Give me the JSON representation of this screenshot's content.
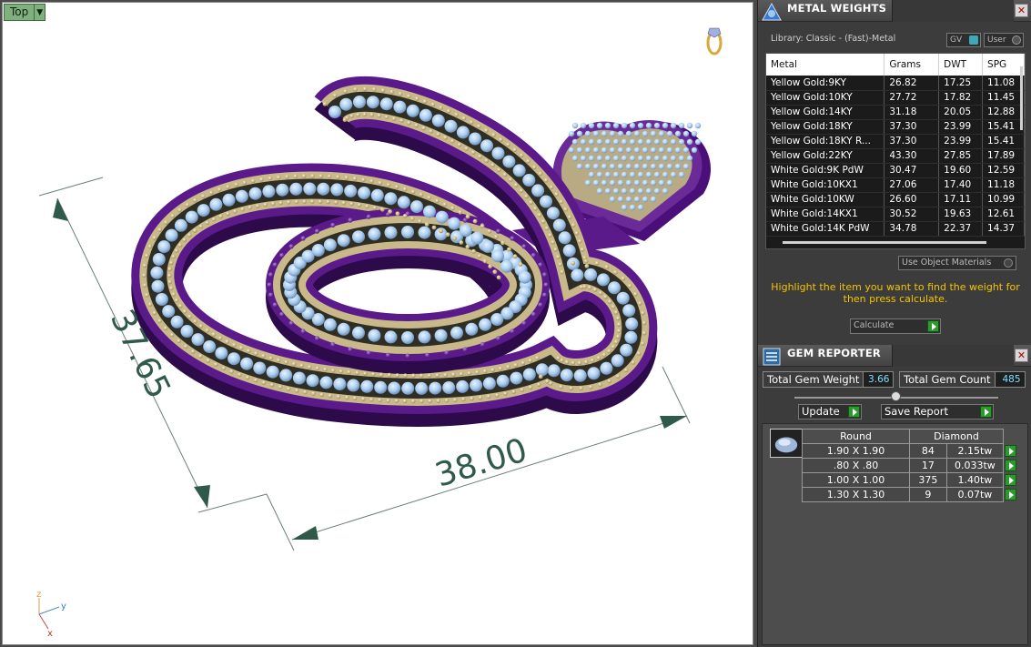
{
  "viewport": {
    "view_name": "Top",
    "dimension_vertical": "37.65",
    "dimension_horizontal": "38.00",
    "axis": {
      "z": "z",
      "y": "y",
      "x": "x"
    },
    "view_cube_icon": "ring-icon"
  },
  "metal_weights": {
    "title": "METAL WEIGHTS",
    "library": "Library: Classic - (Fast)-Metal",
    "toggle_gv": "GV",
    "toggle_user": "User",
    "columns": [
      "Metal",
      "Grams",
      "DWT",
      "SPG"
    ],
    "rows": [
      [
        "Yellow Gold:9KY",
        "26.82",
        "17.25",
        "11.08"
      ],
      [
        "Yellow Gold:10KY",
        "27.72",
        "17.82",
        "11.45"
      ],
      [
        "Yellow Gold:14KY",
        "31.18",
        "20.05",
        "12.88"
      ],
      [
        "Yellow Gold:18KY",
        "37.30",
        "23.99",
        "15.41"
      ],
      [
        "Yellow Gold:18KY R...",
        "37.30",
        "23.99",
        "15.41"
      ],
      [
        "Yellow Gold:22KY",
        "43.30",
        "27.85",
        "17.89"
      ],
      [
        "White Gold:9K PdW",
        "30.47",
        "19.60",
        "12.59"
      ],
      [
        "White Gold:10KX1",
        "27.06",
        "17.40",
        "11.18"
      ],
      [
        "White Gold:10KW",
        "26.60",
        "17.11",
        "10.99"
      ],
      [
        "White Gold:14KX1",
        "30.52",
        "19.63",
        "12.61"
      ],
      [
        "White Gold:14K PdW",
        "34.78",
        "22.37",
        "14.37"
      ]
    ],
    "use_object_materials": "Use Object Materials",
    "hint": "Highlight the item you want to find the weight for then press calculate.",
    "calculate": "Calculate"
  },
  "gem_reporter": {
    "title": "GEM REPORTER",
    "total_weight_label": "Total Gem Weight",
    "total_weight": "3.66",
    "total_count_label": "Total Gem Count",
    "total_count": "485",
    "update": "Update",
    "save_report": "Save Report",
    "shape": "Round",
    "stone": "Diamond",
    "rows": [
      [
        "1.90 X 1.90",
        "84",
        "2.15tw"
      ],
      [
        ".80 X .80",
        "17",
        "0.033tw"
      ],
      [
        "1.00 X 1.00",
        "375",
        "1.40tw"
      ],
      [
        "1.30 X 1.30",
        "9",
        "0.07tw"
      ]
    ]
  },
  "colors": {
    "metal_purple": "#5a1a8a",
    "gold": "#c9b98a",
    "gem_blue": "#a9cdef",
    "highlight_text": "#f5c400",
    "value_text": "#7fe0ff"
  }
}
